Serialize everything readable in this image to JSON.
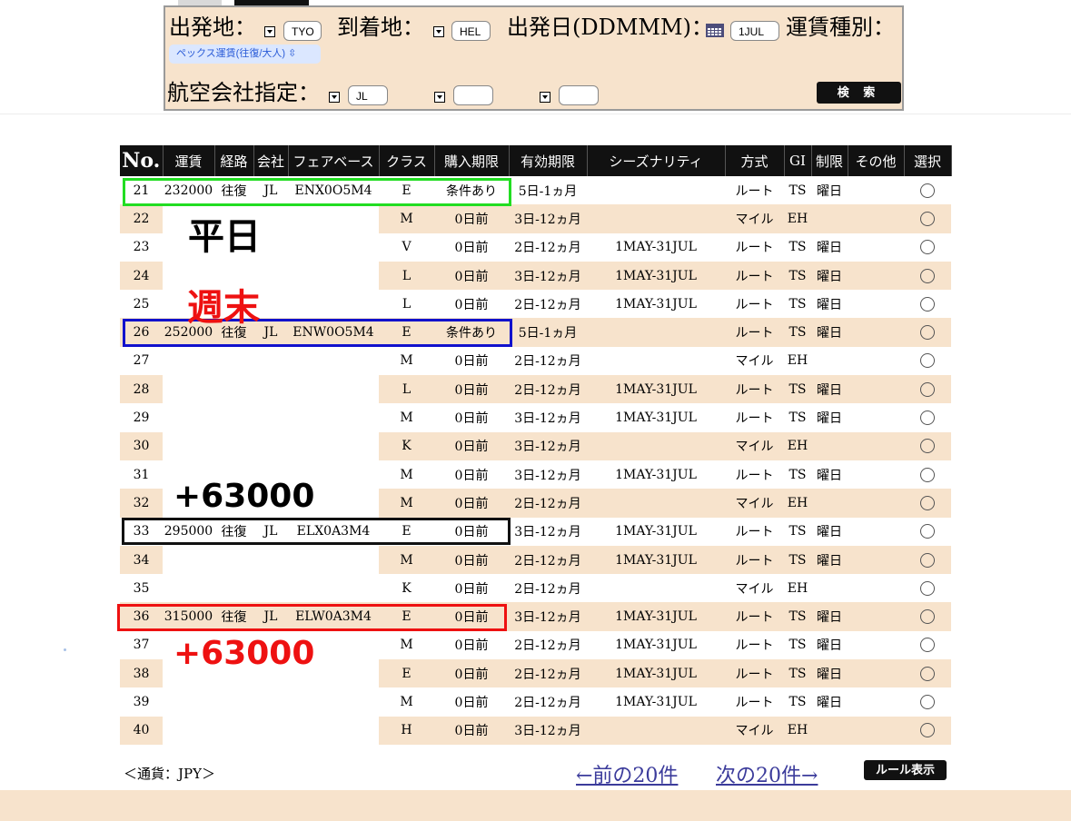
{
  "search": {
    "origin_label": "出発地：",
    "origin_value": "TYO",
    "dest_label": "到着地：",
    "dest_value": "HEL",
    "date_label": "出発日(DDMMM)：",
    "date_value": "1JUL",
    "fare_type_label": "運賃種別：",
    "fare_type_value": "ペックス運賃(往復/大人)",
    "airline_label": "航空会社指定：",
    "airline_value1": "JL",
    "airline_value2": "",
    "airline_value3": "",
    "search_button": "検 索"
  },
  "table": {
    "headers": [
      "No.",
      "運賃",
      "経路",
      "会社",
      "フェアベース",
      "クラス",
      "購入期限",
      "有効期限",
      "シーズナリティ",
      "方式",
      "GI",
      "制限",
      "その他",
      "選択"
    ],
    "rows": [
      {
        "no": "21",
        "fare": "232000",
        "route": "往復",
        "company": "JL",
        "basis": "ENX0O5M4",
        "class": "E",
        "deadline": "条件あり",
        "validity": "5日-1ヵ月",
        "season": "",
        "method": "ルート",
        "gi": "TS",
        "restriction": "曜日",
        "other": ""
      },
      {
        "no": "22",
        "fare": "",
        "route": "",
        "company": "",
        "basis": "",
        "class": "M",
        "deadline": "0日前",
        "validity": "3日-12ヵ月",
        "season": "",
        "method": "マイル",
        "gi": "EH",
        "restriction": "",
        "other": ""
      },
      {
        "no": "23",
        "fare": "",
        "route": "",
        "company": "",
        "basis": "",
        "class": "V",
        "deadline": "0日前",
        "validity": "2日-12ヵ月",
        "season": "1MAY-31JUL",
        "method": "ルート",
        "gi": "TS",
        "restriction": "曜日",
        "other": ""
      },
      {
        "no": "24",
        "fare": "",
        "route": "",
        "company": "",
        "basis": "",
        "class": "L",
        "deadline": "0日前",
        "validity": "3日-12ヵ月",
        "season": "1MAY-31JUL",
        "method": "ルート",
        "gi": "TS",
        "restriction": "曜日",
        "other": ""
      },
      {
        "no": "25",
        "fare": "",
        "route": "",
        "company": "",
        "basis": "",
        "class": "L",
        "deadline": "0日前",
        "validity": "2日-12ヵ月",
        "season": "1MAY-31JUL",
        "method": "ルート",
        "gi": "TS",
        "restriction": "曜日",
        "other": ""
      },
      {
        "no": "26",
        "fare": "252000",
        "route": "往復",
        "company": "JL",
        "basis": "ENW0O5M4",
        "class": "E",
        "deadline": "条件あり",
        "validity": "5日-1ヵ月",
        "season": "",
        "method": "ルート",
        "gi": "TS",
        "restriction": "曜日",
        "other": ""
      },
      {
        "no": "27",
        "fare": "",
        "route": "",
        "company": "",
        "basis": "",
        "class": "M",
        "deadline": "0日前",
        "validity": "2日-12ヵ月",
        "season": "",
        "method": "マイル",
        "gi": "EH",
        "restriction": "",
        "other": ""
      },
      {
        "no": "28",
        "fare": "",
        "route": "",
        "company": "",
        "basis": "",
        "class": "L",
        "deadline": "0日前",
        "validity": "2日-12ヵ月",
        "season": "1MAY-31JUL",
        "method": "ルート",
        "gi": "TS",
        "restriction": "曜日",
        "other": ""
      },
      {
        "no": "29",
        "fare": "",
        "route": "",
        "company": "",
        "basis": "",
        "class": "M",
        "deadline": "0日前",
        "validity": "3日-12ヵ月",
        "season": "1MAY-31JUL",
        "method": "ルート",
        "gi": "TS",
        "restriction": "曜日",
        "other": ""
      },
      {
        "no": "30",
        "fare": "",
        "route": "",
        "company": "",
        "basis": "",
        "class": "K",
        "deadline": "0日前",
        "validity": "3日-12ヵ月",
        "season": "",
        "method": "マイル",
        "gi": "EH",
        "restriction": "",
        "other": ""
      },
      {
        "no": "31",
        "fare": "",
        "route": "",
        "company": "",
        "basis": "",
        "class": "M",
        "deadline": "0日前",
        "validity": "3日-12ヵ月",
        "season": "1MAY-31JUL",
        "method": "ルート",
        "gi": "TS",
        "restriction": "曜日",
        "other": ""
      },
      {
        "no": "32",
        "fare": "",
        "route": "",
        "company": "",
        "basis": "",
        "class": "M",
        "deadline": "0日前",
        "validity": "2日-12ヵ月",
        "season": "",
        "method": "マイル",
        "gi": "EH",
        "restriction": "",
        "other": ""
      },
      {
        "no": "33",
        "fare": "295000",
        "route": "往復",
        "company": "JL",
        "basis": "ELX0A3M4",
        "class": "E",
        "deadline": "0日前",
        "validity": "3日-12ヵ月",
        "season": "1MAY-31JUL",
        "method": "ルート",
        "gi": "TS",
        "restriction": "曜日",
        "other": ""
      },
      {
        "no": "34",
        "fare": "",
        "route": "",
        "company": "",
        "basis": "",
        "class": "M",
        "deadline": "0日前",
        "validity": "2日-12ヵ月",
        "season": "1MAY-31JUL",
        "method": "ルート",
        "gi": "TS",
        "restriction": "曜日",
        "other": ""
      },
      {
        "no": "35",
        "fare": "",
        "route": "",
        "company": "",
        "basis": "",
        "class": "K",
        "deadline": "0日前",
        "validity": "2日-12ヵ月",
        "season": "",
        "method": "マイル",
        "gi": "EH",
        "restriction": "",
        "other": ""
      },
      {
        "no": "36",
        "fare": "315000",
        "route": "往復",
        "company": "JL",
        "basis": "ELW0A3M4",
        "class": "E",
        "deadline": "0日前",
        "validity": "3日-12ヵ月",
        "season": "1MAY-31JUL",
        "method": "ルート",
        "gi": "TS",
        "restriction": "曜日",
        "other": ""
      },
      {
        "no": "37",
        "fare": "",
        "route": "",
        "company": "",
        "basis": "",
        "class": "M",
        "deadline": "0日前",
        "validity": "2日-12ヵ月",
        "season": "1MAY-31JUL",
        "method": "ルート",
        "gi": "TS",
        "restriction": "曜日",
        "other": ""
      },
      {
        "no": "38",
        "fare": "",
        "route": "",
        "company": "",
        "basis": "",
        "class": "E",
        "deadline": "0日前",
        "validity": "2日-12ヵ月",
        "season": "1MAY-31JUL",
        "method": "ルート",
        "gi": "TS",
        "restriction": "曜日",
        "other": ""
      },
      {
        "no": "39",
        "fare": "",
        "route": "",
        "company": "",
        "basis": "",
        "class": "M",
        "deadline": "0日前",
        "validity": "2日-12ヵ月",
        "season": "1MAY-31JUL",
        "method": "ルート",
        "gi": "TS",
        "restriction": "曜日",
        "other": ""
      },
      {
        "no": "40",
        "fare": "",
        "route": "",
        "company": "",
        "basis": "",
        "class": "H",
        "deadline": "0日前",
        "validity": "3日-12ヵ月",
        "season": "",
        "method": "マイル",
        "gi": "EH",
        "restriction": "",
        "other": ""
      }
    ]
  },
  "annotations": {
    "weekday": "平日",
    "weekend": "週末",
    "diff1": "+63000",
    "diff2": "+63000",
    "colors": {
      "green": "#22dd22",
      "blue": "#1111cc",
      "black": "#111111",
      "red": "#ee1111"
    }
  },
  "footer": {
    "currency": "＜通貨：JPY＞",
    "prev": "←前の20件",
    "next": "次の20件→",
    "rule_button": "ルール表示"
  }
}
